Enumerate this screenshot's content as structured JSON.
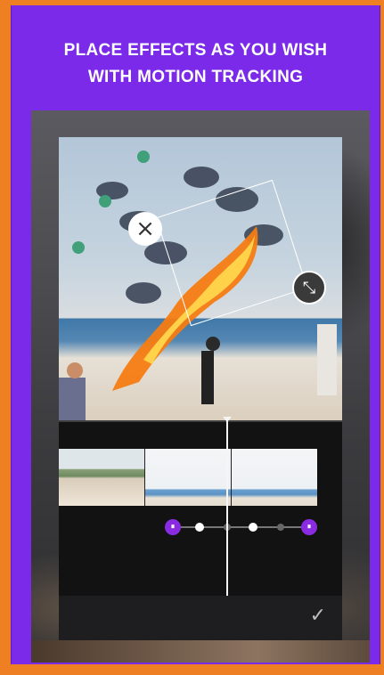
{
  "headline": {
    "line1": "PLACE EFFECTS AS YOU WISH",
    "line2": "WITH MOTION TRACKING"
  },
  "colors": {
    "background": "#ee7f22",
    "card": "#7a2ae8",
    "accent": "#8a2be2"
  },
  "editor": {
    "close_icon": "×",
    "scale_icon": "⤡",
    "confirm_icon": "✓"
  },
  "timeline": {
    "start_handle": "⏸",
    "end_handle": "⏸",
    "keyframes": [
      "start",
      "on",
      "off",
      "on",
      "off",
      "end"
    ]
  }
}
